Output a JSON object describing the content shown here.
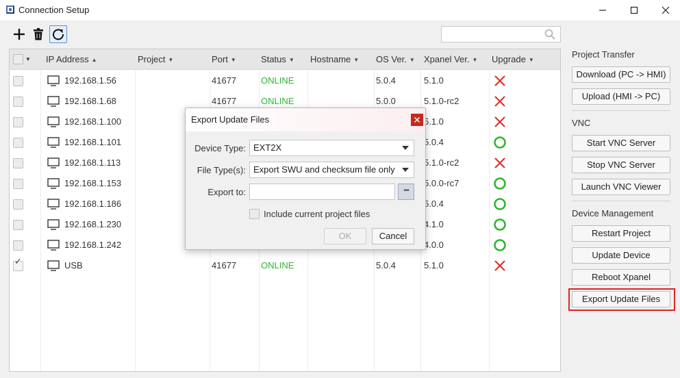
{
  "window": {
    "title": "Connection Setup",
    "minimize_icon": "minimize-icon",
    "maximize_icon": "maximize-icon",
    "close_icon": "close-icon"
  },
  "toolbar": {
    "add_icon": "plus-icon",
    "delete_icon": "trash-icon",
    "refresh_icon": "refresh-icon"
  },
  "search": {
    "value": "",
    "icon": "search-icon"
  },
  "table": {
    "columns": [
      "IP Address",
      "Project",
      "Port",
      "Status",
      "Hostname",
      "OS Ver.",
      "Xpanel Ver.",
      "Upgrade"
    ],
    "sort_column": "IP Address",
    "rows": [
      {
        "checked": false,
        "ip": "192.168.1.56",
        "project": "",
        "port": "41677",
        "status": "ONLINE",
        "hostname": "",
        "os": "5.0.4",
        "xpanel": "5.1.0",
        "upgrade": "x"
      },
      {
        "checked": false,
        "ip": "192.168.1.68",
        "project": "",
        "port": "41677",
        "status": "ONLINE",
        "hostname": "",
        "os": "5.0.0",
        "xpanel": "5.1.0-rc2",
        "upgrade": "x"
      },
      {
        "checked": false,
        "ip": "192.168.1.100",
        "project": "",
        "port": "",
        "status": "",
        "hostname": "",
        "os": "",
        "xpanel": "5.1.0",
        "upgrade": "x"
      },
      {
        "checked": false,
        "ip": "192.168.1.101",
        "project": "",
        "port": "",
        "status": "",
        "hostname": "",
        "os": "",
        "xpanel": "5.0.4",
        "upgrade": "ok"
      },
      {
        "checked": false,
        "ip": "192.168.1.113",
        "project": "",
        "port": "",
        "status": "",
        "hostname": "",
        "os": "",
        "xpanel": "5.1.0-rc2",
        "upgrade": "x"
      },
      {
        "checked": false,
        "ip": "192.168.1.153",
        "project": "",
        "port": "",
        "status": "",
        "hostname": "",
        "os": "",
        "xpanel": "5.0.0-rc7",
        "upgrade": "ok"
      },
      {
        "checked": false,
        "ip": "192.168.1.186",
        "project": "",
        "port": "",
        "status": "",
        "hostname": "",
        "os": "",
        "xpanel": "5.0.4",
        "upgrade": "ok"
      },
      {
        "checked": false,
        "ip": "192.168.1.230",
        "project": "",
        "port": "",
        "status": "",
        "hostname": "",
        "os": "",
        "xpanel": "4.1.0",
        "upgrade": "ok"
      },
      {
        "checked": false,
        "ip": "192.168.1.242",
        "project": "",
        "port": "",
        "status": "",
        "hostname": "",
        "os": "",
        "xpanel": "4.0.0",
        "upgrade": "ok"
      },
      {
        "checked": true,
        "ip": "USB",
        "project": "",
        "port": "41677",
        "status": "ONLINE",
        "hostname": "",
        "os": "5.0.4",
        "xpanel": "5.1.0",
        "upgrade": "x"
      }
    ]
  },
  "side_panel": {
    "project_transfer": {
      "label": "Project Transfer",
      "download": "Download (PC -> HMI)",
      "upload": "Upload (HMI -> PC)"
    },
    "vnc": {
      "label": "VNC",
      "start": "Start VNC Server",
      "stop": "Stop VNC Server",
      "launch": "Launch VNC Viewer"
    },
    "device_management": {
      "label": "Device Management",
      "restart": "Restart Project",
      "update": "Update Device",
      "reboot": "Reboot Xpanel",
      "export": "Export Update Files"
    }
  },
  "dialog": {
    "title": "Export Update Files",
    "close_label": "x",
    "device_type_label": "Device Type:",
    "device_type_value": "EXT2X",
    "file_types_label": "File Type(s):",
    "file_types_value": "Export SWU and checksum file only",
    "export_to_label": "Export to:",
    "export_to_value": "",
    "browse_label": "•••",
    "include_label": "Include current project files",
    "include_checked": false,
    "ok_label": "OK",
    "cancel_label": "Cancel"
  },
  "colors": {
    "online": "#2fb52f",
    "upgrade_x": "#e0322b",
    "upgrade_ok": "#2fb52f",
    "highlight": "#e02424",
    "dialog_close": "#c42b1c"
  }
}
